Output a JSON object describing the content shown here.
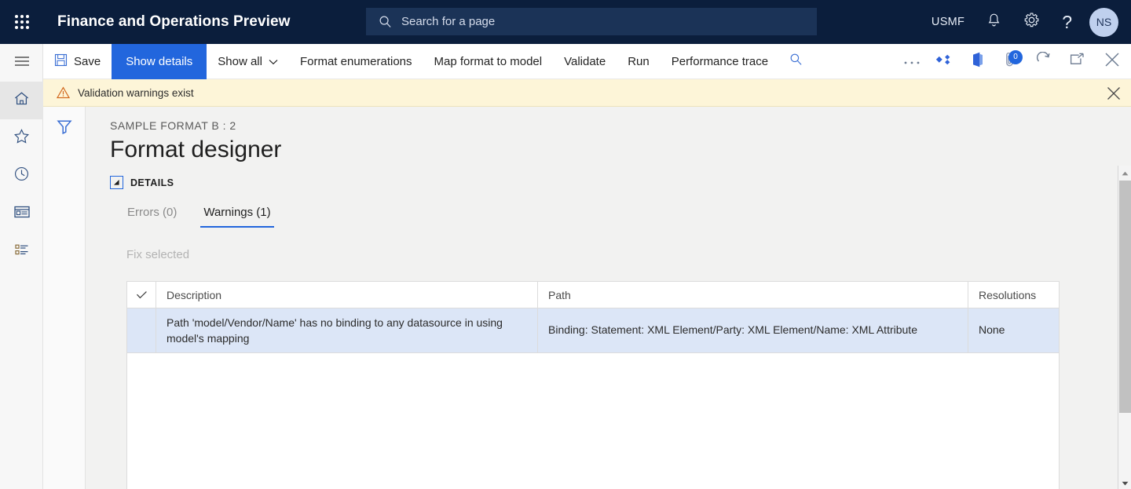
{
  "header": {
    "waffle_label": "app-launcher",
    "title": "Finance and Operations Preview",
    "search_placeholder": "Search for a page",
    "company": "USMF",
    "avatar_initials": "NS",
    "bg_color": "#0b1e3c",
    "search_bg": "#1b3357"
  },
  "rail": {
    "items": [
      {
        "icon": "hamburger-menu-icon",
        "label": "Expand the navigation pane"
      },
      {
        "icon": "home-icon",
        "label": "Home",
        "active": true
      },
      {
        "icon": "star-icon",
        "label": "Favorites"
      },
      {
        "icon": "clock-icon",
        "label": "Recent"
      },
      {
        "icon": "workspace-icon",
        "label": "Workspaces"
      },
      {
        "icon": "modules-list-icon",
        "label": "Modules"
      }
    ]
  },
  "toolbar": {
    "save_label": "Save",
    "show_details_label": "Show details",
    "show_all_label": "Show all",
    "format_enumerations_label": "Format enumerations",
    "map_format_label": "Map format to model",
    "validate_label": "Validate",
    "run_label": "Run",
    "performance_trace_label": "Performance trace",
    "attachment_badge": "0",
    "accent_color": "#2266dd",
    "right_icons": [
      "overflow-ellipsis-icon",
      "share-diamond-icon",
      "office-app-icon",
      "attachment-icon",
      "refresh-icon",
      "open-in-new-window-icon",
      "close-icon"
    ]
  },
  "warning_bar": {
    "message": "Validation warnings exist",
    "icon": "warning-triangle-icon",
    "bg_color": "#fdf5d8"
  },
  "filter_pane": {
    "icon": "filter-funnel-icon"
  },
  "page": {
    "breadcrumb": "SAMPLE FORMAT B : 2",
    "title": "Format designer",
    "section_label": "DETAILS"
  },
  "tabs": [
    {
      "label": "Errors (0)",
      "active": false
    },
    {
      "label": "Warnings (1)",
      "active": true
    }
  ],
  "actions": {
    "fix_selected_label": "Fix selected",
    "fix_selected_disabled": true
  },
  "table": {
    "columns": [
      "",
      "Description",
      "Path",
      "Resolutions"
    ],
    "rows": [
      {
        "selected": true,
        "description": "Path 'model/Vendor/Name' has no binding to any datasource in using model's mapping",
        "path": "Binding: Statement: XML Element/Party: XML Element/Name: XML Attribute",
        "resolutions": "None"
      }
    ],
    "selected_row_color": "#dce6f7"
  },
  "scrollbar": {
    "up": "scroll-up-arrow-icon",
    "down": "scroll-down-arrow-icon"
  }
}
